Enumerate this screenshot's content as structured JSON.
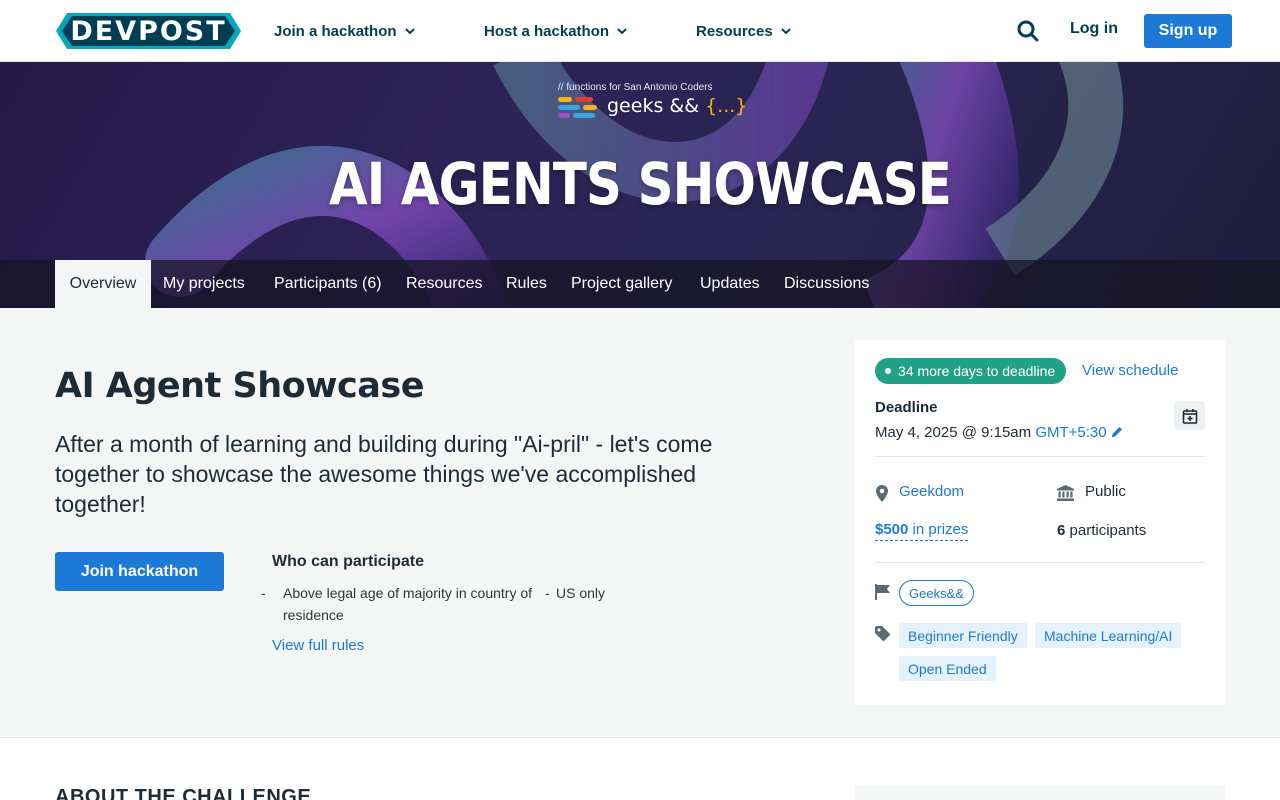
{
  "brand": {
    "name": "DEVPOST",
    "primary": "#1c7ad6",
    "dark": "#003e54",
    "teal": "#21a288"
  },
  "nav": {
    "join": "Join a hackathon",
    "host": "Host a hackathon",
    "resources": "Resources",
    "login": "Log in",
    "signup": "Sign up"
  },
  "banner": {
    "org_tag": "// functions for San Antonio Coders",
    "org_name": "geeks &&",
    "org_braces": "{...}",
    "title": "AI AGENTS SHOWCASE"
  },
  "tabs": [
    "Overview",
    "My projects",
    "Participants (6)",
    "Resources",
    "Rules",
    "Project gallery",
    "Updates",
    "Discussions"
  ],
  "main": {
    "title": "AI Agent Showcase",
    "tagline": "After a month of learning and building during \"Ai-pril\" - let's come together to showcase the awesome things we've accomplished together!",
    "join_button": "Join hackathon",
    "who_title": "Who can participate",
    "eligibility": [
      "Above legal age of majority in country of residence",
      "US only"
    ],
    "full_rules": "View full rules"
  },
  "sidebar": {
    "days_left": "34 more days to deadline",
    "view_schedule": "View schedule",
    "deadline_label": "Deadline",
    "deadline_date": "May 4, 2025 @ 9:15am",
    "timezone": "GMT+5:30",
    "location": "Geekdom",
    "visibility": "Public",
    "prize_amount": "$500",
    "prize_suffix": " in prizes",
    "participant_count": "6",
    "participant_label": " participants",
    "host": "Geeks&&",
    "themes": [
      "Beginner Friendly",
      "Machine Learning/AI",
      "Open Ended"
    ]
  },
  "about": {
    "title": "ABOUT THE CHALLENGE"
  }
}
